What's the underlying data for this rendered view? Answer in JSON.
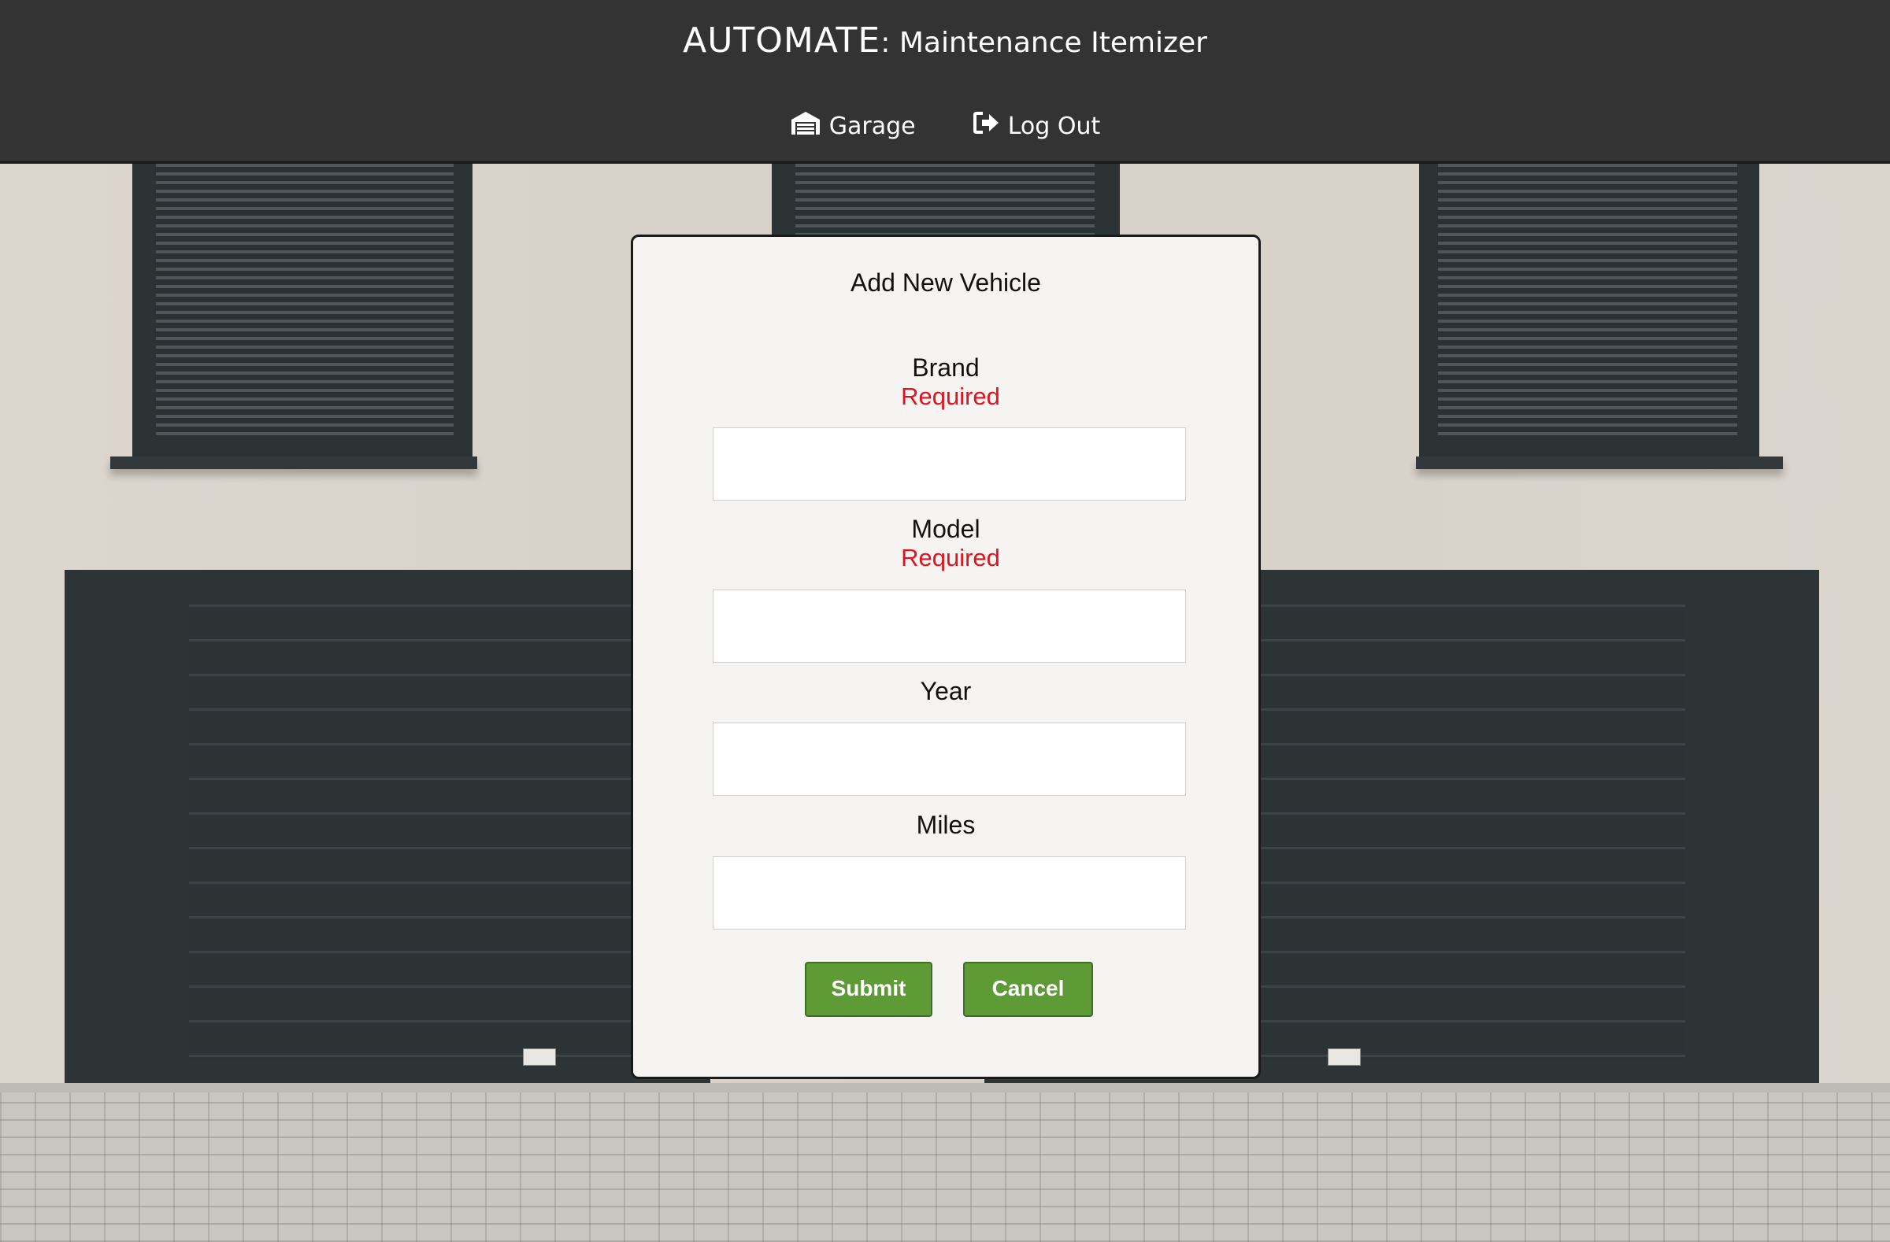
{
  "header": {
    "title_main": "AUTOMATE",
    "title_colon": ":",
    "title_sub": " Maintenance Itemizer",
    "nav": [
      {
        "label": "Garage",
        "icon": "garage-icon"
      },
      {
        "label": "Log Out",
        "icon": "sign-out-icon"
      }
    ]
  },
  "form": {
    "title": "Add New Vehicle",
    "fields": [
      {
        "label": "Brand",
        "error": "Required",
        "value": ""
      },
      {
        "label": "Model",
        "error": "Required",
        "value": ""
      },
      {
        "label": "Year",
        "value": ""
      },
      {
        "label": "Miles",
        "value": ""
      }
    ],
    "submit_label": "Submit",
    "cancel_label": "Cancel"
  },
  "colors": {
    "header_bg": "#333333",
    "error_text": "#e3111b",
    "button_green": "#5e9b37",
    "card_bg": "#f5f4f2"
  }
}
